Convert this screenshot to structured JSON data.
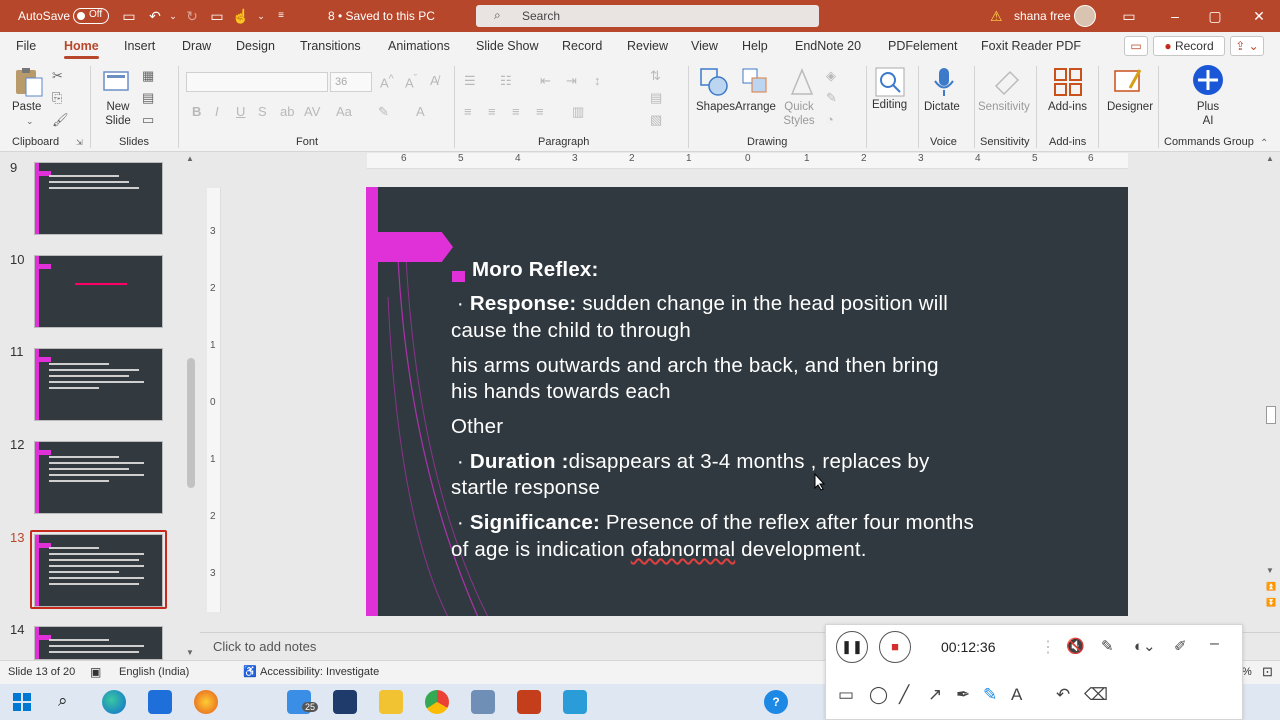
{
  "colors": {
    "accent": "#b7472a",
    "slide_bg": "#30393f",
    "magenta": "#e030d8"
  },
  "titlebar": {
    "autosave_label": "AutoSave",
    "autosave_state": "Off",
    "doc_status": "8 • Saved to this PC",
    "search_placeholder": "Search",
    "user_name": "shana free",
    "warning_icon": "⚠"
  },
  "menu": {
    "tabs": [
      "File",
      "Home",
      "Insert",
      "Draw",
      "Design",
      "Transitions",
      "Animations",
      "Slide Show",
      "Record",
      "Review",
      "View",
      "Help",
      "EndNote 20",
      "PDFelement",
      "Foxit Reader PDF"
    ],
    "record_button": "Record"
  },
  "ribbon": {
    "clipboard": {
      "paste": "Paste",
      "group": "Clipboard"
    },
    "slides": {
      "new_slide": "New Slide",
      "group": "Slides"
    },
    "font": {
      "size": "36",
      "group": "Font"
    },
    "paragraph": {
      "group": "Paragraph"
    },
    "drawing": {
      "shapes": "Shapes",
      "arrange": "Arrange",
      "quick_styles": "Quick Styles",
      "group": "Drawing"
    },
    "editing": {
      "label": "Editing"
    },
    "voice": {
      "dictate": "Dictate",
      "group": "Voice"
    },
    "sensitivity": {
      "label": "Sensitivity",
      "group": "Sensitivity"
    },
    "addins": {
      "label": "Add-ins",
      "group": "Add-ins"
    },
    "designer": {
      "label": "Designer"
    },
    "plus": {
      "label": "Plus AI",
      "group": "Commands Group"
    }
  },
  "thumbnails": [
    {
      "num": "9"
    },
    {
      "num": "10"
    },
    {
      "num": "11"
    },
    {
      "num": "12"
    },
    {
      "num": "13",
      "selected": true
    },
    {
      "num": "14"
    }
  ],
  "ruler": {
    "h": [
      "6",
      "5",
      "4",
      "3",
      "2",
      "1",
      "0",
      "1",
      "2",
      "3",
      "4",
      "5",
      "6"
    ],
    "v": [
      "3",
      "2",
      "1",
      "0",
      "1",
      "2",
      "3"
    ]
  },
  "slide": {
    "title": "Moro Reflex:",
    "resp_label": "Response:",
    "resp_text": " sudden change in the head position will",
    "resp_line2": "cause the child to through",
    "arms_line1": "his arms outwards and arch the back, and then bring",
    "arms_line2": "his hands towards each",
    "other": "Other",
    "dur_label": "Duration :",
    "dur_text": "disappears at 3-4 months , replaces by",
    "dur_line2": "startle response",
    "sig_label": "Significance:",
    "sig_text": " Presence of the reflex after four months",
    "sig_line2_a": "of age is indication ",
    "sig_line2_err": "ofabnormal",
    "sig_line2_b": " development."
  },
  "notes_placeholder": "Click to add notes",
  "status": {
    "slide_of": "Slide 13 of 20",
    "language": "English (India)",
    "accessibility": "Accessibility: Investigate",
    "zoom": "%"
  },
  "recorder": {
    "time": "00:12:36"
  },
  "taskbar": {
    "badge": "25"
  }
}
